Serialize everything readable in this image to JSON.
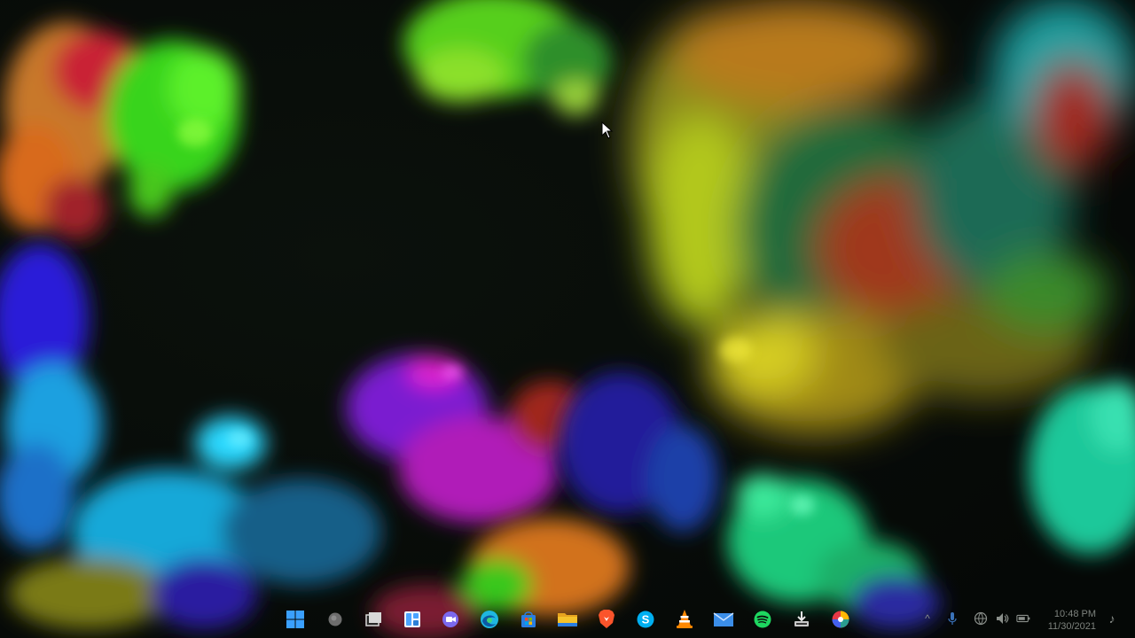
{
  "wallpaper": {
    "name": "fluid-paint-wallpaper",
    "palette": [
      "#39ff14",
      "#ff8c00",
      "#e11d2a",
      "#2f1cff",
      "#18b7ff",
      "#b01cff",
      "#e8e01a",
      "#1ee6a0",
      "#1ec8c8"
    ]
  },
  "taskbar": {
    "pinned": [
      {
        "name": "start-button",
        "icon": "windows-logo-icon",
        "color": "#3aa0ff"
      },
      {
        "name": "search-button",
        "icon": "search-circle-icon",
        "color": "#6d6d6d"
      },
      {
        "name": "task-view-button",
        "icon": "task-view-icon",
        "color": "#d8d8d8"
      },
      {
        "name": "widgets-button",
        "icon": "widgets-icon",
        "color": "#4aa3ff"
      },
      {
        "name": "teams-chat-button",
        "icon": "teams-chat-icon",
        "color": "#7b68ee"
      },
      {
        "name": "edge-button",
        "icon": "edge-browser-icon",
        "color": "#1fb7e0"
      },
      {
        "name": "store-button",
        "icon": "microsoft-store-icon",
        "color": "#2a7de1"
      },
      {
        "name": "file-explorer-button",
        "icon": "folder-icon",
        "color": "#f5c22b"
      },
      {
        "name": "brave-button",
        "icon": "brave-lion-icon",
        "color": "#fb542b"
      },
      {
        "name": "skype-button",
        "icon": "skype-icon",
        "color": "#00aff0"
      },
      {
        "name": "vlc-button",
        "icon": "vlc-cone-icon",
        "color": "#ff8800"
      },
      {
        "name": "mail-button",
        "icon": "mail-icon",
        "color": "#3b8ee8"
      },
      {
        "name": "spotify-button",
        "icon": "spotify-icon",
        "color": "#1ed760"
      },
      {
        "name": "installer-button",
        "icon": "download-box-icon",
        "color": "#c9c9c9"
      },
      {
        "name": "color-app-button",
        "icon": "color-wheel-icon",
        "color": "#e63946"
      }
    ],
    "tray": {
      "overflow_glyph": "^",
      "icons": [
        "chevron-up-icon",
        "microphone-icon",
        "network-icon",
        "speaker-icon",
        "battery-icon"
      ],
      "notification_glyph": "♪"
    },
    "clock": {
      "time": "10:48 PM",
      "date": "11/30/2021"
    }
  }
}
